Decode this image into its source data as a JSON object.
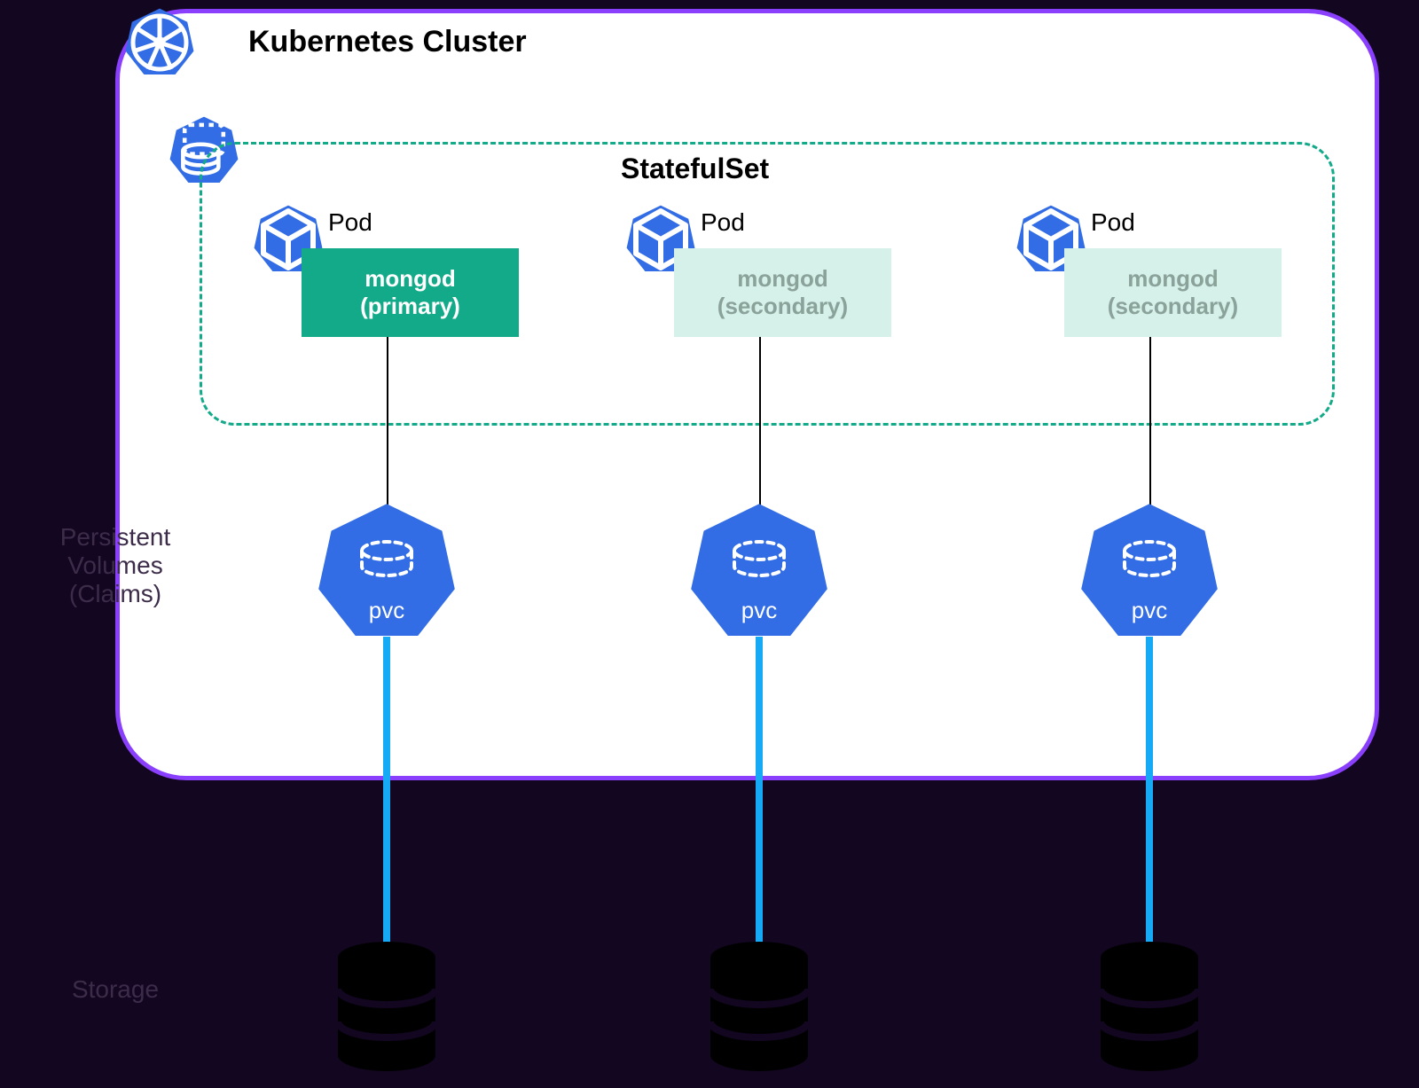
{
  "cluster": {
    "title": "Kubernetes Cluster"
  },
  "statefulset": {
    "title": "StatefulSet"
  },
  "pods": [
    {
      "label": "Pod",
      "name": "mongod",
      "role": "(primary)",
      "variant": "primary"
    },
    {
      "label": "Pod",
      "name": "mongod",
      "role": "(secondary)",
      "variant": "secondary"
    },
    {
      "label": "Pod",
      "name": "mongod",
      "role": "(secondary)",
      "variant": "secondary"
    }
  ],
  "pvc": {
    "label": "pvc"
  },
  "sections": {
    "pv_line1": "Persistent",
    "pv_line2": "Volumes (Claims)",
    "storage": "Storage"
  },
  "colors": {
    "k8s_blue": "#326de6",
    "accent_teal": "#13aa8a",
    "dashed_teal": "#13aa8a",
    "connector_blue": "#16a9f5",
    "bg": "#130621",
    "cluster_border": "#8a3ffc",
    "secondary_bg": "#d5f1e9"
  },
  "icons": {
    "wheel": "k8s-wheel-icon",
    "stack": "database-stack-icon",
    "cube": "cube-icon",
    "dashed_cylinder": "dashed-cylinder-icon",
    "storage": "storage-cylinder-icon"
  }
}
